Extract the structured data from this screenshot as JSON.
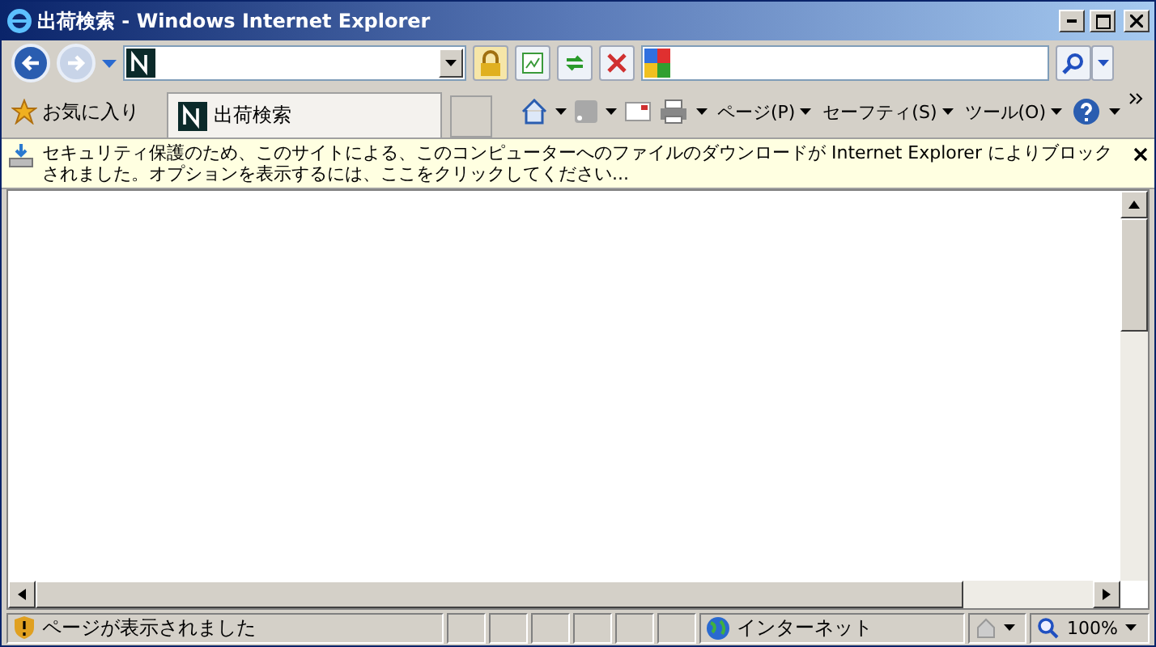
{
  "window": {
    "title": "出荷検索 - Windows Internet Explorer"
  },
  "favorites": {
    "label": "お気に入り"
  },
  "tabs": [
    {
      "label": "出荷検索",
      "selected": true
    }
  ],
  "command_bar": [
    {
      "label": "ページ(P)"
    },
    {
      "label": "セーフティ(S)"
    },
    {
      "label": "ツール(O)"
    }
  ],
  "info_bar": {
    "message": "セキュリティ保護のため、このサイトによる、このコンピューターへのファイルのダウンロードが Internet Explorer によりブロックされました。オプションを表示するには、ここをクリックしてください..."
  },
  "status_bar": {
    "message": "ページが表示されました",
    "zone": "インターネット",
    "zoom": "100%"
  }
}
